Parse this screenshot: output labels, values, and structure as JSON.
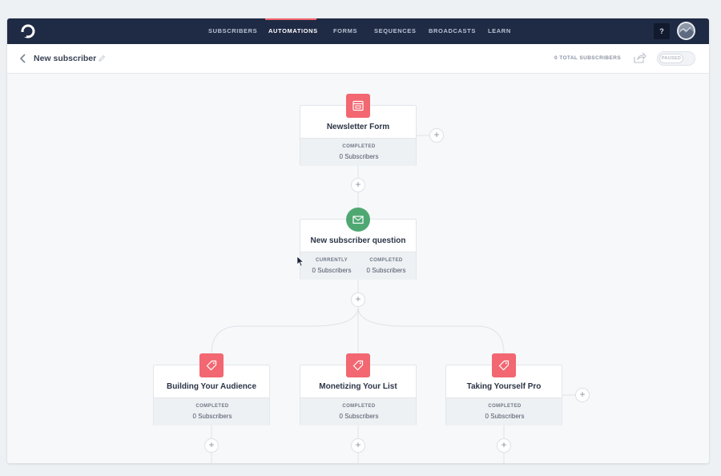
{
  "nav": {
    "items": [
      "SUBSCRIBERS",
      "AUTOMATIONS",
      "FORMS",
      "SEQUENCES",
      "BROADCASTS",
      "LEARN"
    ],
    "active": "AUTOMATIONS",
    "help_label": "?"
  },
  "header": {
    "title": "New subscriber",
    "total_subscribers": "0 TOTAL SUBSCRIBERS",
    "toggle_label": "PAUSED"
  },
  "flow": {
    "form_node": {
      "title": "Newsletter Form",
      "stat_label": "COMPLETED",
      "stat_value": "0 Subscribers",
      "icon": "form-icon"
    },
    "question_node": {
      "title": "New subscriber question",
      "stat1_label": "CURRENTLY",
      "stat1_value": "0 Subscribers",
      "stat2_label": "COMPLETED",
      "stat2_value": "0 Subscribers",
      "icon": "email-icon"
    },
    "branches": [
      {
        "title": "Building Your Audience",
        "stat_label": "COMPLETED",
        "stat_value": "0 Subscribers",
        "icon": "tag-icon"
      },
      {
        "title": "Monetizing Your List",
        "stat_label": "COMPLETED",
        "stat_value": "0 Subscribers",
        "icon": "tag-icon"
      },
      {
        "title": "Taking Yourself Pro",
        "stat_label": "COMPLETED",
        "stat_value": "0 Subscribers",
        "icon": "tag-icon"
      }
    ],
    "plus_label": "+"
  },
  "colors": {
    "nav_bg": "#1f2a44",
    "accent_red": "#f26771",
    "accent_green": "#4fa872"
  }
}
